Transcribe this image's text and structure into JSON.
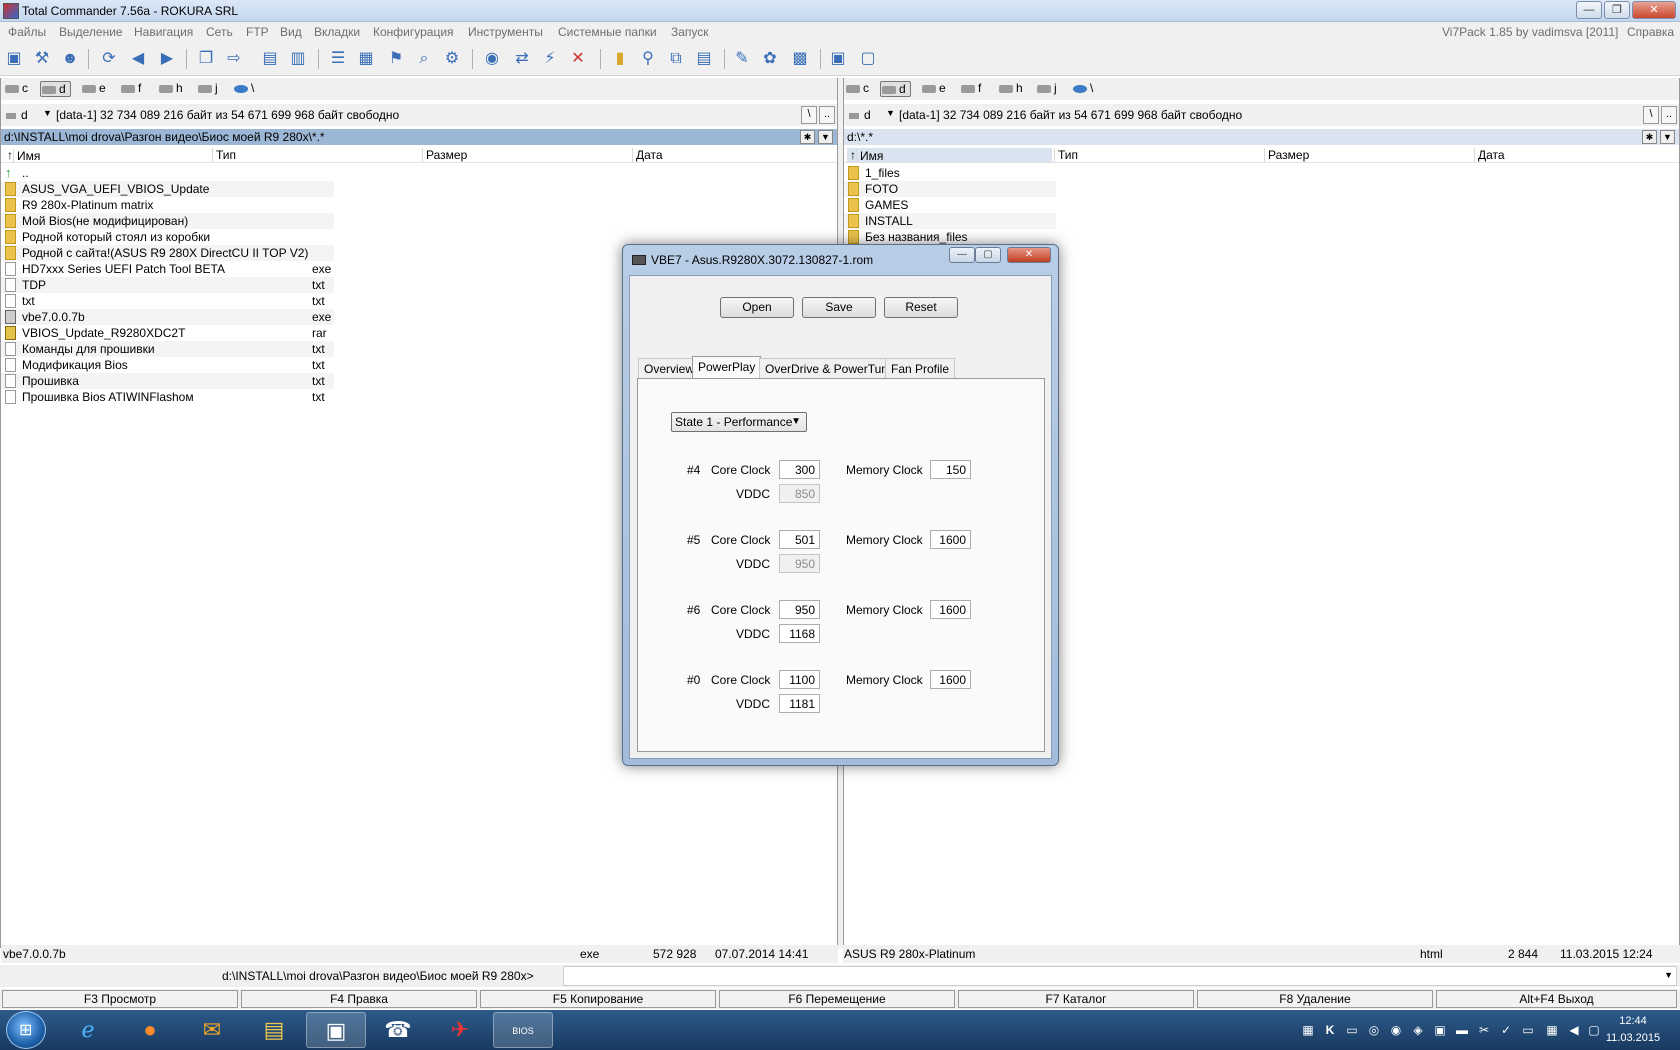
{
  "window": {
    "title": "Total Commander 7.56a - ROKURA SRL"
  },
  "menu": {
    "items": [
      "Файлы",
      "Выделение",
      "Навигация",
      "Сеть",
      "FTP",
      "Вид",
      "Вкладки",
      "Конфигурация",
      "Инструменты",
      "Системные папки",
      "Запуск"
    ],
    "right": "Vi7Pack 1.85 by vadimsva  [2011]",
    "help": "Справка"
  },
  "drives": [
    "c",
    "d",
    "e",
    "f",
    "h",
    "j",
    "\\"
  ],
  "left": {
    "drive": "d",
    "info": "[data-1]  32 734 089 216 байт из 54 671 699 968 байт свободно",
    "path": "d:\\INSTALL\\moi drova\\Разгон видео\\Биос моей R9 280x\\*.*",
    "headers": [
      "Имя",
      "Тип",
      "Размер",
      "Дата"
    ],
    "files": [
      {
        "name": "..",
        "ext": "",
        "icon": "up"
      },
      {
        "name": "ASUS_VGA_UEFI_VBIOS_Update",
        "ext": "",
        "icon": "folder"
      },
      {
        "name": "R9 280x-Platinum matrix",
        "ext": "",
        "icon": "folder"
      },
      {
        "name": "Мой Bios(не модифицирован)",
        "ext": "",
        "icon": "folder"
      },
      {
        "name": "Родной который стоял из коробки",
        "ext": "",
        "icon": "folder"
      },
      {
        "name": "Родной с сайта!(ASUS R9 280X DirectCU II TOP V2)",
        "ext": "",
        "icon": "folder"
      },
      {
        "name": "HD7xxx Series UEFI Patch Tool BETA",
        "ext": "exe",
        "icon": "file"
      },
      {
        "name": "TDP",
        "ext": "txt",
        "icon": "file"
      },
      {
        "name": "txt",
        "ext": "txt",
        "icon": "file"
      },
      {
        "name": "vbe7.0.0.7b",
        "ext": "exe",
        "icon": "exe"
      },
      {
        "name": "VBIOS_Update_R9280XDC2T",
        "ext": "rar",
        "icon": "rar"
      },
      {
        "name": "Команды для прошивки",
        "ext": "txt",
        "icon": "file"
      },
      {
        "name": "Модификация Bios",
        "ext": "txt",
        "icon": "file"
      },
      {
        "name": "Прошивка",
        "ext": "txt",
        "icon": "file"
      },
      {
        "name": "Прошивка Bios ATIWINFlashом",
        "ext": "txt",
        "icon": "file"
      }
    ],
    "status": {
      "name": "vbe7.0.0.7b",
      "ext": "exe",
      "size": "572 928",
      "date": "07.07.2014 14:41"
    }
  },
  "right": {
    "drive": "d",
    "info": "[data-1]  32 734 089 216 байт из 54 671 699 968 байт свободно",
    "path": "d:\\*.*",
    "headers": [
      "Имя",
      "Тип",
      "Размер",
      "Дата"
    ],
    "files": [
      {
        "name": "1_files",
        "icon": "folder"
      },
      {
        "name": "FOTO",
        "icon": "folder"
      },
      {
        "name": "GAMES",
        "icon": "folder"
      },
      {
        "name": "INSTALL",
        "icon": "folder"
      },
      {
        "name": "Без названия_files",
        "icon": "folder"
      }
    ],
    "status": {
      "name": "ASUS R9 280x-Platinum",
      "ext": "html",
      "size": "2 844",
      "date": "11.03.2015 12:24"
    }
  },
  "cmdline": {
    "path": "d:\\INSTALL\\moi drova\\Разгон видео\\Биос моей R9 280x>"
  },
  "fkeys": [
    "F3 Просмотр",
    "F4 Правка",
    "F5 Копирование",
    "F6 Перемещение",
    "F7 Каталог",
    "F8 Удаление",
    "Alt+F4 Выход"
  ],
  "taskbar": {
    "time": "12:44",
    "date": "11.03.2015",
    "active_app": "BIOS"
  },
  "vbe": {
    "title": "VBE7 - Asus.R9280X.3072.130827-1.rom",
    "buttons": [
      "Open",
      "Save",
      "Reset"
    ],
    "tabs": [
      "Overview",
      "PowerPlay",
      "OverDrive & PowerTune",
      "Fan Profile"
    ],
    "active_tab": "PowerPlay",
    "state_select": "State 1 - Performance",
    "labels": {
      "core": "Core Clock",
      "memory": "Memory Clock",
      "vddc": "VDDC"
    },
    "states": [
      {
        "id": "#4",
        "core": "300",
        "memory": "150",
        "vddc": "850",
        "vddc_disabled": true
      },
      {
        "id": "#5",
        "core": "501",
        "memory": "1600",
        "vddc": "950",
        "vddc_disabled": true
      },
      {
        "id": "#6",
        "core": "950",
        "memory": "1600",
        "vddc": "1168",
        "vddc_disabled": false
      },
      {
        "id": "#0",
        "core": "1100",
        "memory": "1600",
        "vddc": "1181",
        "vddc_disabled": false
      }
    ]
  }
}
